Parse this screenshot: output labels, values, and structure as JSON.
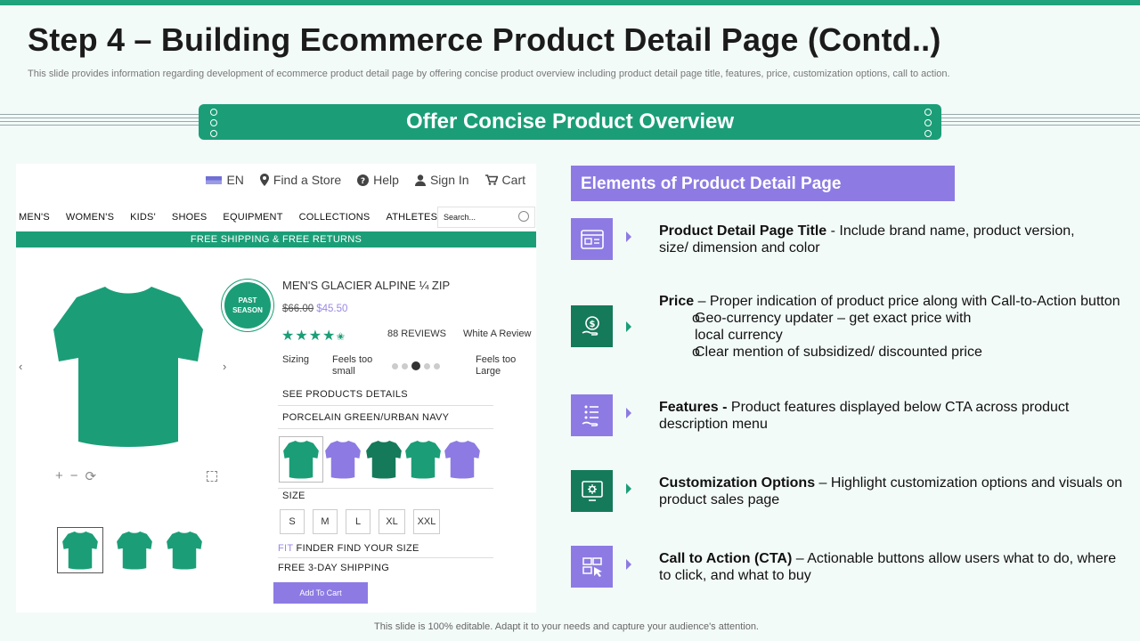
{
  "slide": {
    "title": "Step 4 – Building Ecommerce Product Detail Page (Contd..)",
    "subtitle": "This slide provides information regarding development of ecommerce product detail page by offering concise product overview including product detail page title, features, price, customization options, call to action.",
    "banner": "Offer Concise Product Overview",
    "footer": "This slide is 100% editable. Adapt it to your needs and capture your audience's attention."
  },
  "mock": {
    "utility": {
      "lang": "EN",
      "store": "Find a Store",
      "help": "Help",
      "signin": "Sign In",
      "cart": "Cart"
    },
    "nav": [
      "MEN'S",
      "WOMEN'S",
      "KIDS'",
      "SHOES",
      "EQUIPMENT",
      "COLLECTIONS",
      "ATHLETES"
    ],
    "search_placeholder": "Search...",
    "shipping": "FREE  SHIPPING  & FREE  RETURNS",
    "arrow_left": "‹",
    "arrow_right": "›",
    "badge_line1": "PAST",
    "badge_line2": "SEASON",
    "product_name": "MEN'S GLACIER  ALPINE  ¼ ZIP",
    "price_old": "$66.00",
    "price_new": "$45.50",
    "rating": 4.5,
    "reviews": "88 REVIEWS",
    "write_review": "White A Review",
    "sizing_label": "Sizing",
    "sizing_small": "Feels too small",
    "sizing_large": "Feels too Large",
    "see_details": "SEE  PRODUCTS  DETAILS",
    "colors": "PORCELAIN  GREEN/URBAN  NAVY",
    "size_label": "SIZE",
    "sizes": [
      "S",
      "M",
      "L",
      "XL",
      "XXL"
    ],
    "fit_highlight": "FIT",
    "fit_rest": " FINDER   FIND  YOUR SIZE",
    "free_shipping": "FREE  3-DAY SHIPPING",
    "add_to_cart": "Add To Cart",
    "swatch_colors": [
      "#1b9e77",
      "#8d7be3",
      "#157a5a",
      "#1b9e77",
      "#8d7be3"
    ],
    "tee_color": "#1b9e77"
  },
  "panel": {
    "heading": "Elements of Product Detail Page",
    "items": [
      {
        "icon": "browser-window-icon",
        "icon_bg": "#8d7be3",
        "bold": "Product Detail Page Title",
        "text": " - Include  brand name, product version, size/ dimension and color"
      },
      {
        "icon": "hand-dollar-icon",
        "icon_bg": "#157a5a",
        "bold": "Price",
        "text": " – Proper indication of product price along with Call-to-Action button",
        "bullets": [
          {
            "mark": "o",
            "text": "Geo-currency  updater – get exact price with local currency"
          },
          {
            "mark": "o",
            "text": "Clear mention  of subsidized/ discounted price"
          }
        ]
      },
      {
        "icon": "checklist-hand-icon",
        "icon_bg": "#8d7be3",
        "bold": "Features -",
        "text": " Product features displayed below CTA across product description menu"
      },
      {
        "icon": "customize-monitor-icon",
        "icon_bg": "#157a5a",
        "bold": "Customization Options",
        "text": " – Highlight customization options and visuals on product sales page"
      },
      {
        "icon": "cta-click-icon",
        "icon_bg": "#8d7be3",
        "bold": "Call to Action (CTA)",
        "text": " – Actionable buttons allow users what to do, where to click, and what to buy"
      }
    ]
  },
  "colors": {
    "accent_green": "#1b9e77",
    "accent_purple": "#8d7be3",
    "dark_green": "#157a5a"
  }
}
